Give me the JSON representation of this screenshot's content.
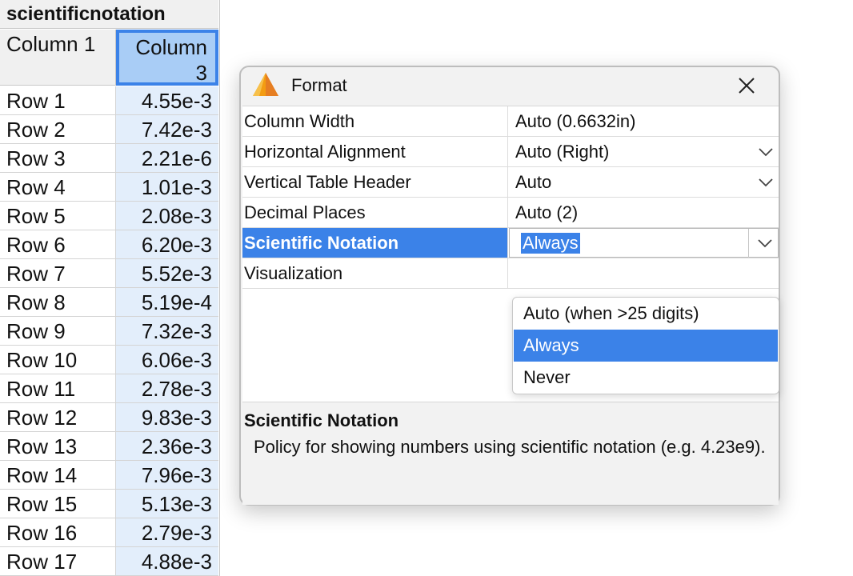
{
  "table": {
    "title": "scientificnotation",
    "columns": [
      "Column 1",
      "Column 3"
    ],
    "rows": [
      {
        "label": "Row 1",
        "value": "4.55e-3"
      },
      {
        "label": "Row 2",
        "value": "7.42e-3"
      },
      {
        "label": "Row 3",
        "value": "2.21e-6"
      },
      {
        "label": "Row 4",
        "value": "1.01e-3"
      },
      {
        "label": "Row 5",
        "value": "2.08e-3"
      },
      {
        "label": "Row 6",
        "value": "6.20e-3"
      },
      {
        "label": "Row 7",
        "value": "5.52e-3"
      },
      {
        "label": "Row 8",
        "value": "5.19e-4"
      },
      {
        "label": "Row 9",
        "value": "7.32e-3"
      },
      {
        "label": "Row 10",
        "value": "6.06e-3"
      },
      {
        "label": "Row 11",
        "value": "2.78e-3"
      },
      {
        "label": "Row 12",
        "value": "9.83e-3"
      },
      {
        "label": "Row 13",
        "value": "2.36e-3"
      },
      {
        "label": "Row 14",
        "value": "7.96e-3"
      },
      {
        "label": "Row 15",
        "value": "5.13e-3"
      },
      {
        "label": "Row 16",
        "value": "2.79e-3"
      },
      {
        "label": "Row 17",
        "value": "4.88e-3"
      }
    ]
  },
  "dialog": {
    "title": "Format",
    "icon": "app-cone-icon",
    "properties": [
      {
        "name": "Column Width",
        "value": "Auto (0.6632in)",
        "dropdown": false
      },
      {
        "name": "Horizontal Alignment",
        "value": "Auto (Right)",
        "dropdown": true
      },
      {
        "name": "Vertical Table Header",
        "value": "Auto",
        "dropdown": true
      },
      {
        "name": "Decimal Places",
        "value": "Auto (2)",
        "dropdown": false
      },
      {
        "name": "Scientific Notation",
        "value": "Always",
        "dropdown": true
      },
      {
        "name": "Visualization",
        "value": "",
        "dropdown": false
      }
    ],
    "dropdown_options": [
      "Auto (when >25 digits)",
      "Always",
      "Never"
    ],
    "selected_option": "Always",
    "description": {
      "title": "Scientific Notation",
      "text": "Policy for showing numbers using scientific notation (e.g. 4.23e9)."
    }
  },
  "colors": {
    "accent": "#3b82e8",
    "header_highlight": "#a9cdf6",
    "column_tint": "#e3eefb"
  }
}
